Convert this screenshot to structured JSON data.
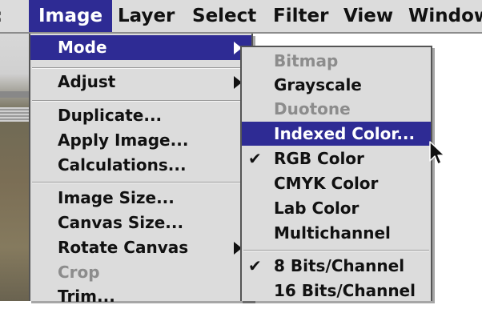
{
  "menubar": {
    "items": [
      {
        "label": "Image"
      },
      {
        "label": "Layer"
      },
      {
        "label": "Select"
      },
      {
        "label": "Filter"
      },
      {
        "label": "View"
      },
      {
        "label": "Window"
      }
    ]
  },
  "image_menu": {
    "items": [
      {
        "label": "Mode"
      },
      {
        "label": "Adjust"
      },
      {
        "label": "Duplicate..."
      },
      {
        "label": "Apply Image..."
      },
      {
        "label": "Calculations..."
      },
      {
        "label": "Image Size..."
      },
      {
        "label": "Canvas Size..."
      },
      {
        "label": "Rotate Canvas"
      },
      {
        "label": "Crop"
      },
      {
        "label": "Trim..."
      }
    ]
  },
  "mode_submenu": {
    "items": [
      {
        "label": "Bitmap"
      },
      {
        "label": "Grayscale"
      },
      {
        "label": "Duotone"
      },
      {
        "label": "Indexed Color..."
      },
      {
        "label": "RGB Color",
        "check": "✔"
      },
      {
        "label": "CMYK Color"
      },
      {
        "label": "Lab Color"
      },
      {
        "label": "Multichannel"
      },
      {
        "label": "8 Bits/Channel",
        "check": "✔"
      },
      {
        "label": "16 Bits/Channel"
      }
    ]
  },
  "colors": {
    "highlight": "#2e2b94",
    "menu_bg": "#dcdcdc",
    "disabled_text": "#8c8c8c"
  },
  "icons": {
    "submenu_arrow": "triangle-right-icon",
    "checkmark": "checkmark-icon",
    "cursor": "arrow-cursor-icon"
  }
}
